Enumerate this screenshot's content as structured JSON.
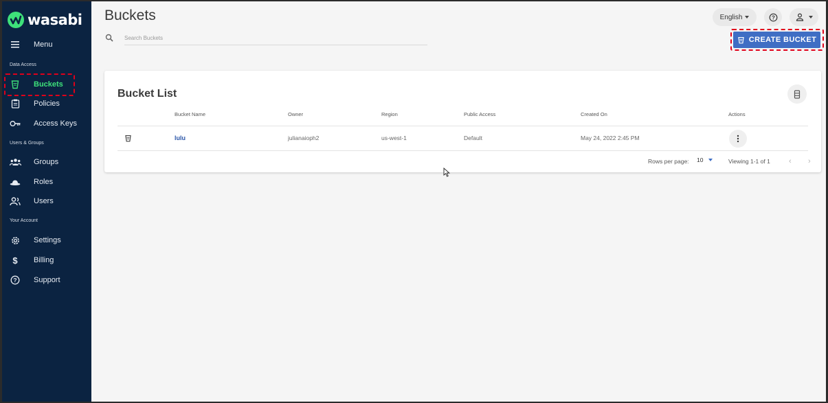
{
  "brand": {
    "name": "wasabi",
    "color": "#3ee07a"
  },
  "sidebar": {
    "menu_label": "Menu",
    "sections": {
      "data_access": "Data Access",
      "users_groups": "Users & Groups",
      "your_account": "Your Account"
    },
    "items": [
      {
        "label": "Buckets",
        "icon": "bucket-icon",
        "active": true
      },
      {
        "label": "Policies",
        "icon": "clipboard-icon"
      },
      {
        "label": "Access Keys",
        "icon": "key-icon"
      },
      {
        "label": "Groups",
        "icon": "groups-icon"
      },
      {
        "label": "Roles",
        "icon": "hat-icon"
      },
      {
        "label": "Users",
        "icon": "users-icon"
      },
      {
        "label": "Settings",
        "icon": "gear-icon"
      },
      {
        "label": "Billing",
        "icon": "dollar-icon"
      },
      {
        "label": "Support",
        "icon": "help-icon"
      }
    ]
  },
  "header": {
    "title": "Buckets",
    "search_placeholder": "Search Buckets",
    "language": "English",
    "create_label": "CREATE BUCKET"
  },
  "bucket_list": {
    "title": "Bucket List",
    "columns": [
      "Bucket Name",
      "Owner",
      "Region",
      "Public Access",
      "Created On",
      "Actions"
    ],
    "rows": [
      {
        "name": "lulu",
        "owner": "julianaioph2",
        "region": "us-west-1",
        "public_access": "Default",
        "created_on": "May 24, 2022 2:45 PM"
      }
    ],
    "rows_per_page_label": "Rows per page:",
    "rows_per_page": "10",
    "viewing": "Viewing 1-1 of 1"
  },
  "colors": {
    "sidebar_bg": "#0b2341",
    "accent": "#3f6ec4",
    "highlight": "#e0001a"
  }
}
